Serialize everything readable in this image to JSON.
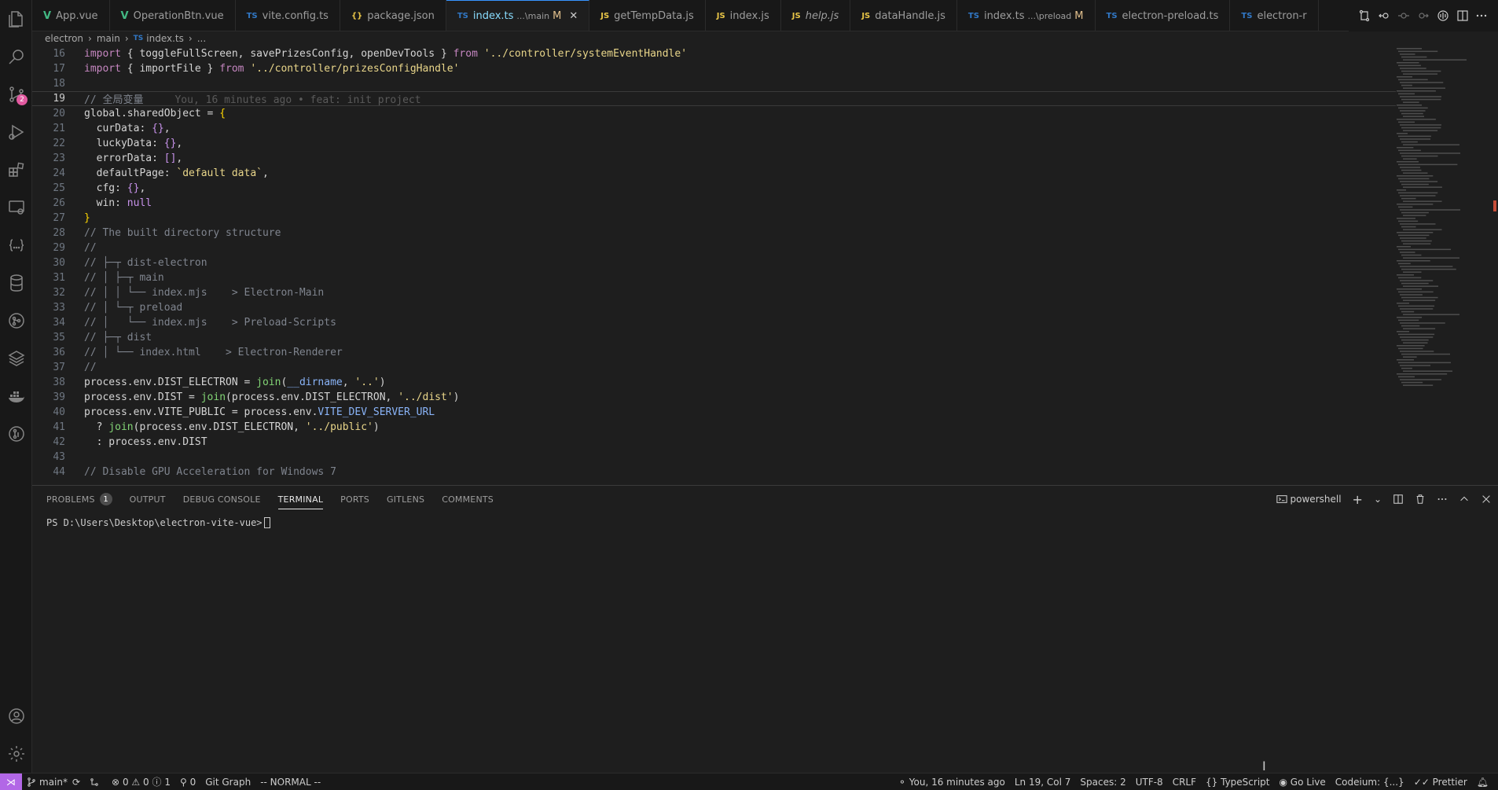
{
  "tabs": [
    {
      "icon": "V",
      "icon_class": "ic-vue",
      "name": "App.vue",
      "sub": "",
      "mod": "",
      "italic": false,
      "active": false
    },
    {
      "icon": "V",
      "icon_class": "ic-vue",
      "name": "OperationBtn.vue",
      "sub": "",
      "mod": "",
      "italic": false,
      "active": false
    },
    {
      "icon": "TS",
      "icon_class": "ic-ts",
      "name": "vite.config.ts",
      "sub": "",
      "mod": "",
      "italic": false,
      "active": false
    },
    {
      "icon": "{}",
      "icon_class": "ic-json",
      "name": "package.json",
      "sub": "",
      "mod": "",
      "italic": false,
      "active": false
    },
    {
      "icon": "TS",
      "icon_class": "ic-ts",
      "name": "index.ts",
      "sub": "...\\main",
      "mod": "M",
      "italic": false,
      "active": true
    },
    {
      "icon": "JS",
      "icon_class": "ic-js",
      "name": "getTempData.js",
      "sub": "",
      "mod": "",
      "italic": false,
      "active": false
    },
    {
      "icon": "JS",
      "icon_class": "ic-js",
      "name": "index.js",
      "sub": "",
      "mod": "",
      "italic": false,
      "active": false
    },
    {
      "icon": "JS",
      "icon_class": "ic-js",
      "name": "help.js",
      "sub": "",
      "mod": "",
      "italic": true,
      "active": false
    },
    {
      "icon": "JS",
      "icon_class": "ic-js",
      "name": "dataHandle.js",
      "sub": "",
      "mod": "",
      "italic": false,
      "active": false
    },
    {
      "icon": "TS",
      "icon_class": "ic-ts",
      "name": "index.ts",
      "sub": "...\\preload",
      "mod": "M",
      "italic": false,
      "active": false
    },
    {
      "icon": "TS",
      "icon_class": "ic-ts",
      "name": "electron-preload.ts",
      "sub": "",
      "mod": "",
      "italic": false,
      "active": false
    },
    {
      "icon": "TS",
      "icon_class": "ic-ts",
      "name": "electron-r",
      "sub": "",
      "mod": "",
      "italic": false,
      "active": false
    }
  ],
  "breadcrumb": {
    "p1": "electron",
    "p2": "main",
    "ts": "TS",
    "file": "index.ts",
    "tail": "..."
  },
  "editor": {
    "lines": [
      {
        "n": "16",
        "html": "<span class=\"kw\">import</span> { toggleFullScreen, savePrizesConfig, openDevTools } <span class=\"kw\">from</span> <span class=\"str\">'../controller/systemEventHandle'</span>"
      },
      {
        "n": "17",
        "html": "<span class=\"kw\">import</span> { importFile } <span class=\"kw\">from</span> <span class=\"str\">'../controller/prizesConfigHandle'</span>"
      },
      {
        "n": "18",
        "html": ""
      },
      {
        "n": "19",
        "html": "<span class=\"cm\">// 全局变量</span><span class=\"blame\">You, 16 minutes ago • feat: init project</span>",
        "cur": true
      },
      {
        "n": "20",
        "html": "global.sharedObject = <span class=\"br\">{</span>"
      },
      {
        "n": "21",
        "html": "  curData: <span class=\"purple\">{}</span>,"
      },
      {
        "n": "22",
        "html": "  luckyData: <span class=\"purple\">{}</span>,"
      },
      {
        "n": "23",
        "html": "  errorData: <span class=\"purple\">[]</span>,"
      },
      {
        "n": "24",
        "html": "  defaultPage: <span class=\"str\">`default data`</span>,"
      },
      {
        "n": "25",
        "html": "  cfg: <span class=\"purple\">{}</span>,"
      },
      {
        "n": "26",
        "html": "  win: <span class=\"purple\">null</span>"
      },
      {
        "n": "27",
        "html": "<span class=\"br\">}</span>"
      },
      {
        "n": "28",
        "html": "<span class=\"cm\">// The built directory structure</span>"
      },
      {
        "n": "29",
        "html": "<span class=\"cm\">//</span>"
      },
      {
        "n": "30",
        "html": "<span class=\"cm\">// ├─┬ dist-electron</span>"
      },
      {
        "n": "31",
        "html": "<span class=\"cm\">// │ ├─┬ main</span>"
      },
      {
        "n": "32",
        "html": "<span class=\"cm\">// │ │ └── index.mjs    > Electron-Main</span>"
      },
      {
        "n": "33",
        "html": "<span class=\"cm\">// │ └─┬ preload</span>"
      },
      {
        "n": "34",
        "html": "<span class=\"cm\">// │   └── index.mjs    > Preload-Scripts</span>"
      },
      {
        "n": "35",
        "html": "<span class=\"cm\">// ├─┬ dist</span>"
      },
      {
        "n": "36",
        "html": "<span class=\"cm\">// │ └── index.html    > Electron-Renderer</span>"
      },
      {
        "n": "37",
        "html": "<span class=\"cm\">//</span>"
      },
      {
        "n": "38",
        "html": "process.env.DIST_ELECTRON = <span class=\"fn\">join</span>(<span class=\"blue\">__dirname</span>, <span class=\"str\">'..'</span>)"
      },
      {
        "n": "39",
        "html": "process.env.DIST = <span class=\"fn\">join</span>(process.env.DIST_ELECTRON, <span class=\"str\">'../dist'</span>)"
      },
      {
        "n": "40",
        "html": "process.env.VITE_PUBLIC = process.env.<span class=\"blue\">VITE_DEV_SERVER_URL</span>"
      },
      {
        "n": "41",
        "html": "  ? <span class=\"fn\">join</span>(process.env.DIST_ELECTRON, <span class=\"str\">'../public'</span>)"
      },
      {
        "n": "42",
        "html": "  : process.env.DIST"
      },
      {
        "n": "43",
        "html": ""
      },
      {
        "n": "44",
        "html": "<span class=\"cm\">// Disable GPU Acceleration for Windows 7</span>"
      }
    ]
  },
  "panel": {
    "tabs": [
      {
        "label": "PROBLEMS",
        "count": "1",
        "active": false
      },
      {
        "label": "OUTPUT",
        "count": "",
        "active": false
      },
      {
        "label": "DEBUG CONSOLE",
        "count": "",
        "active": false
      },
      {
        "label": "TERMINAL",
        "count": "",
        "active": true
      },
      {
        "label": "PORTS",
        "count": "",
        "active": false
      },
      {
        "label": "GITLENS",
        "count": "",
        "active": false
      },
      {
        "label": "COMMENTS",
        "count": "",
        "active": false
      }
    ],
    "shell": "powershell",
    "prompt": "PS D:\\Users\\Desktop\\electron-vite-vue>"
  },
  "status": {
    "branch": "main*",
    "errors": "0",
    "warnings": "0",
    "infos": "1",
    "ports": "0",
    "git_graph": "Git Graph",
    "mode": "-- NORMAL --",
    "blame": "You, 16 minutes ago",
    "position": "Ln 19, Col 7",
    "spaces": "Spaces: 2",
    "encoding": "UTF-8",
    "eol": "CRLF",
    "language": "TypeScript",
    "golive": "Go Live",
    "codeium": "Codeium: {...}",
    "prettier": "Prettier"
  },
  "activity": {
    "scm_badge": "2"
  }
}
